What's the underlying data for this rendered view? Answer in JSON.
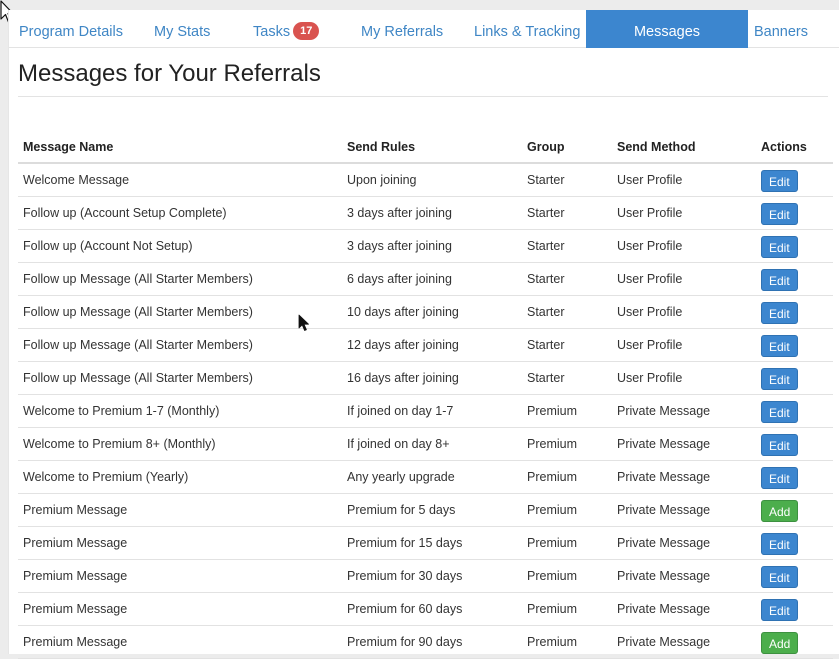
{
  "tabs": [
    {
      "label": "Program Details"
    },
    {
      "label": "My Stats"
    },
    {
      "label": "Tasks",
      "badge": "17"
    },
    {
      "label": "My Referrals"
    },
    {
      "label": "Links & Tracking"
    },
    {
      "label": "Messages",
      "active": true
    },
    {
      "label": "Banners"
    }
  ],
  "page_title": "Messages for Your Referrals",
  "table": {
    "headers": [
      "Message Name",
      "Send Rules",
      "Group",
      "Send Method",
      "Actions"
    ],
    "rows": [
      {
        "name": "Welcome Message",
        "rule": "Upon joining",
        "group": "Starter",
        "method": "User Profile",
        "action": "Edit"
      },
      {
        "name": "Follow up (Account Setup Complete)",
        "rule": "3 days after joining",
        "group": "Starter",
        "method": "User Profile",
        "action": "Edit"
      },
      {
        "name": "Follow up (Account Not Setup)",
        "rule": "3 days after joining",
        "group": "Starter",
        "method": "User Profile",
        "action": "Edit"
      },
      {
        "name": "Follow up Message (All Starter Members)",
        "rule": "6 days after joining",
        "group": "Starter",
        "method": "User Profile",
        "action": "Edit"
      },
      {
        "name": "Follow up Message (All Starter Members)",
        "rule": "10 days after joining",
        "group": "Starter",
        "method": "User Profile",
        "action": "Edit"
      },
      {
        "name": "Follow up Message (All Starter Members)",
        "rule": "12 days after joining",
        "group": "Starter",
        "method": "User Profile",
        "action": "Edit"
      },
      {
        "name": "Follow up Message (All Starter Members)",
        "rule": "16 days after joining",
        "group": "Starter",
        "method": "User Profile",
        "action": "Edit"
      },
      {
        "name": "Welcome to Premium 1-7 (Monthly)",
        "rule": "If joined on day 1-7",
        "group": "Premium",
        "method": "Private Message",
        "action": "Edit"
      },
      {
        "name": "Welcome to Premium 8+ (Monthly)",
        "rule": "If joined on day 8+",
        "group": "Premium",
        "method": "Private Message",
        "action": "Edit"
      },
      {
        "name": "Welcome to Premium (Yearly)",
        "rule": "Any yearly upgrade",
        "group": "Premium",
        "method": "Private Message",
        "action": "Edit"
      },
      {
        "name": "Premium Message",
        "rule": "Premium for 5 days",
        "group": "Premium",
        "method": "Private Message",
        "action": "Add"
      },
      {
        "name": "Premium Message",
        "rule": "Premium for 15 days",
        "group": "Premium",
        "method": "Private Message",
        "action": "Edit"
      },
      {
        "name": "Premium Message",
        "rule": "Premium for 30 days",
        "group": "Premium",
        "method": "Private Message",
        "action": "Edit"
      },
      {
        "name": "Premium Message",
        "rule": "Premium for 60 days",
        "group": "Premium",
        "method": "Private Message",
        "action": "Edit"
      },
      {
        "name": "Premium Message",
        "rule": "Premium for 90 days",
        "group": "Premium",
        "method": "Private Message",
        "action": "Add"
      }
    ]
  },
  "colors": {
    "accent": "#3c86cf",
    "link": "#3f86c5",
    "badge": "#d9534f",
    "add_button": "#4cae4c"
  },
  "icons": [
    "mouse-pointer-icon",
    "mouse-pointer-icon"
  ]
}
